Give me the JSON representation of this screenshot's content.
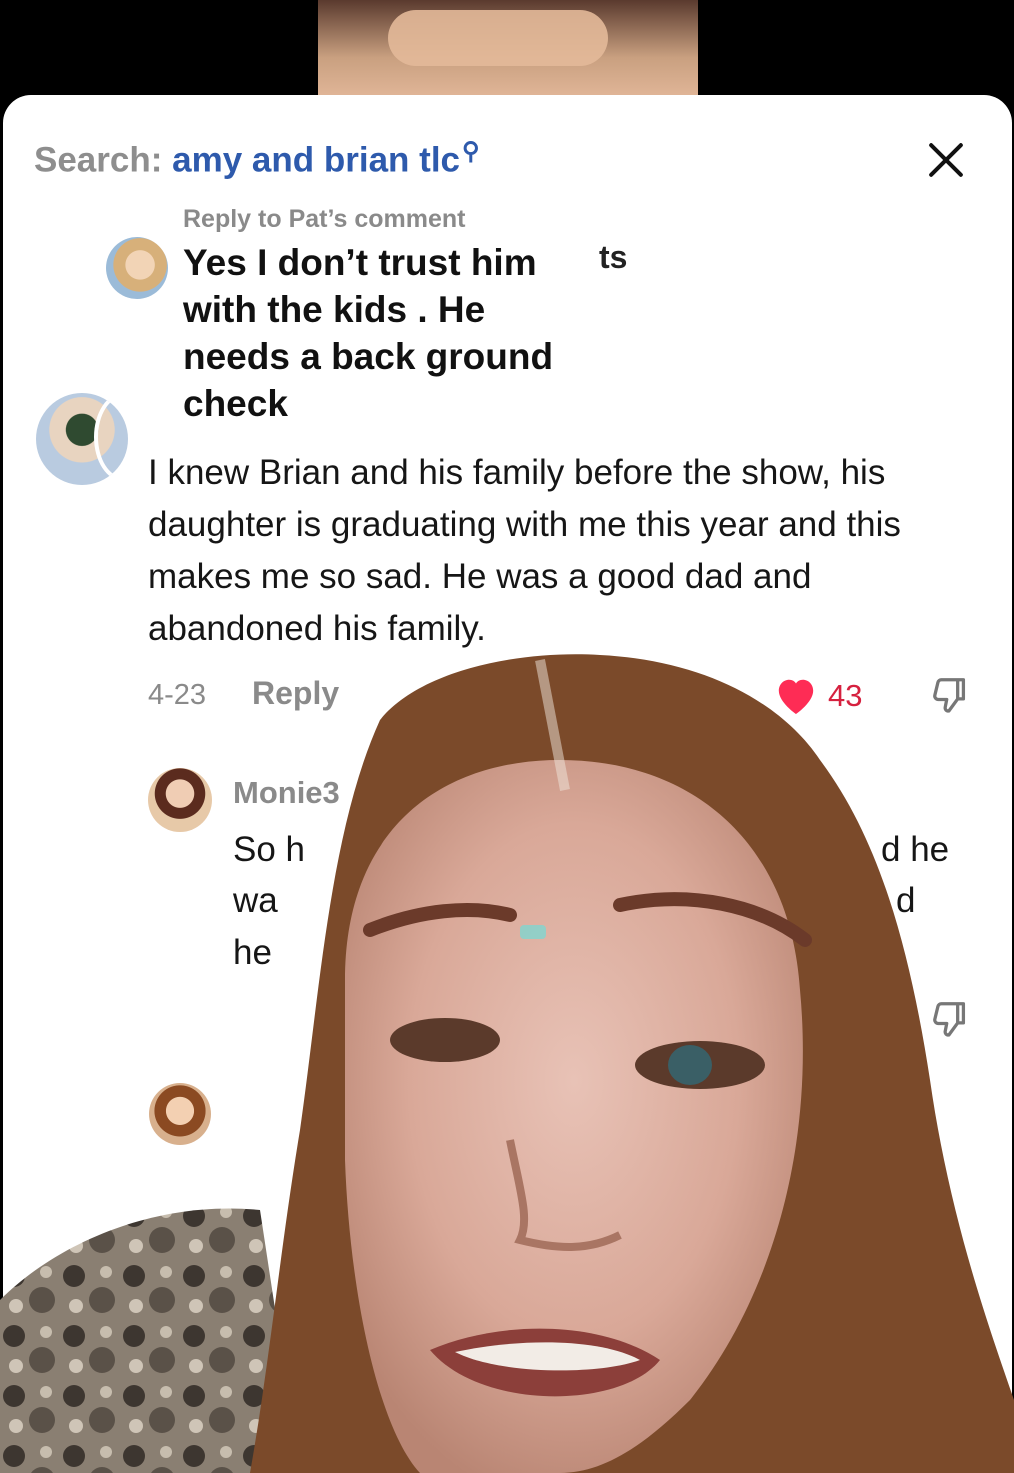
{
  "search": {
    "label": "Search:",
    "query": "amy and brian tlc",
    "icon": "search-icon"
  },
  "close": {
    "icon": "close-icon"
  },
  "parent": {
    "reply_context": "Reply to Pat’s comment",
    "text": "Yes I don’t trust him with the kids . He needs a back ground check",
    "stray_text": "ts"
  },
  "comment": {
    "text": "I knew Brian and his family before the show, his daughter is graduating with me this year and this makes me so sad. He was a good dad and abandoned his family.",
    "date": "4-23",
    "reply_label": "Reply",
    "likes": "43",
    "like_icon": "heart-icon",
    "dislike_icon": "thumbs-down-icon"
  },
  "reply": {
    "username": "Monie3",
    "line1": "So h",
    "line2": "wa",
    "line3": "he",
    "right1": "d he",
    "right2": "d"
  },
  "colors": {
    "accent_link": "#2e5aac",
    "like_red": "#fe2c55",
    "muted_gray": "#8a8a8a",
    "overlay_hair": "#7b4a2a"
  }
}
